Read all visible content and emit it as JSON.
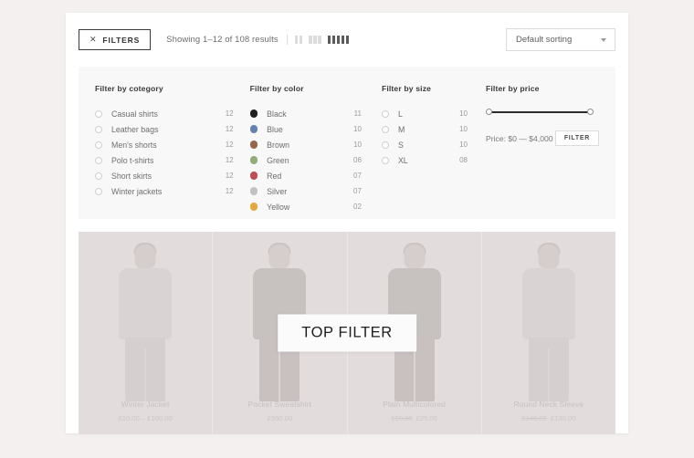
{
  "toolbar": {
    "filters_button": "FILTERS",
    "filters_icon": "close-x-icon",
    "results_text": "Showing 1–12 of 108 results",
    "view_modes": [
      {
        "name": "grid-2-column",
        "columns": 2,
        "active": false
      },
      {
        "name": "grid-3-column",
        "columns": 3,
        "active": false
      },
      {
        "name": "grid-4-column",
        "columns": 4,
        "active": true
      }
    ],
    "sorting": {
      "selected": "Default sorting",
      "caret_icon": "chevron-down-icon"
    }
  },
  "filters": {
    "category": {
      "heading": "Filter by cotegory",
      "items": [
        {
          "label": "Casual shirts",
          "count": "12"
        },
        {
          "label": "Leather bags",
          "count": "12"
        },
        {
          "label": "Men's shorts",
          "count": "12"
        },
        {
          "label": "Polo t-shirts",
          "count": "12"
        },
        {
          "label": "Short skirts",
          "count": "12"
        },
        {
          "label": "Winter jackets",
          "count": "12"
        }
      ]
    },
    "color": {
      "heading": "Filter by color",
      "items": [
        {
          "label": "Black",
          "count": "11",
          "hex": "#22201e"
        },
        {
          "label": "Blue",
          "count": "10",
          "hex": "#6482b0"
        },
        {
          "label": "Brown",
          "count": "10",
          "hex": "#96664a"
        },
        {
          "label": "Green",
          "count": "06",
          "hex": "#92ab78"
        },
        {
          "label": "Red",
          "count": "07",
          "hex": "#bc4e53"
        },
        {
          "label": "Silver",
          "count": "07",
          "hex": "#c2c2c2"
        },
        {
          "label": "Yellow",
          "count": "02",
          "hex": "#e0a93c"
        }
      ]
    },
    "size": {
      "heading": "Filter by size",
      "items": [
        {
          "label": "L",
          "count": "10"
        },
        {
          "label": "M",
          "count": "10"
        },
        {
          "label": "S",
          "count": "10"
        },
        {
          "label": "XL",
          "count": "08"
        }
      ]
    },
    "price": {
      "heading": "Filter by price",
      "range_label": "Price: $0 — $4,000",
      "min": "$0",
      "max": "$4,000",
      "apply_button": "FILTER"
    }
  },
  "products": [
    {
      "title": "Winter Jacket",
      "price": "£10.00 – £100.00",
      "old_price": "",
      "dark": false
    },
    {
      "title": "Pocket Sweatshirt",
      "price": "£550.00",
      "old_price": "",
      "dark": true
    },
    {
      "title": "Plain Multicolored",
      "price": "£25.00",
      "old_price": "£50.00",
      "dark": true
    },
    {
      "title": "Round Neck Sleeve",
      "price": "£130.00",
      "old_price": "£140.00",
      "dark": false
    }
  ],
  "overlay": {
    "badge": "TOP FILTER"
  }
}
